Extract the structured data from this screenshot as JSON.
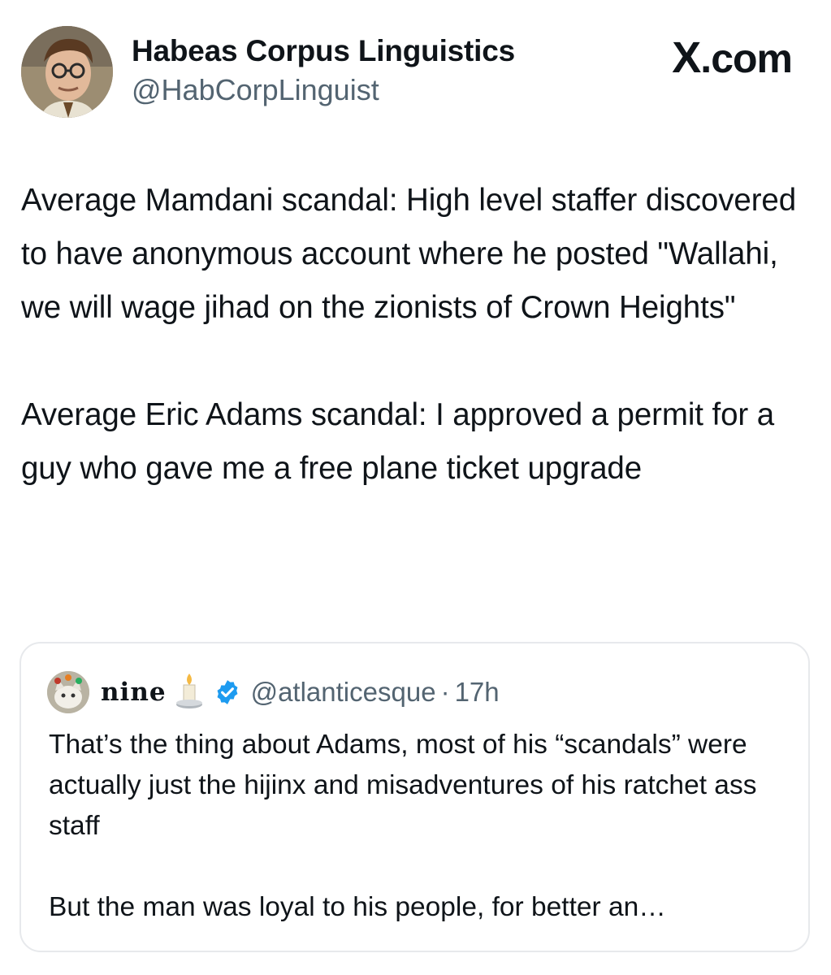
{
  "post": {
    "author_name": "Habeas Corpus Linguistics",
    "author_handle": "@HabCorpLinguist",
    "brand_x": "X",
    "brand_suffix": ".com",
    "paragraphs": [
      "Average Mamdani scandal: High level staffer discovered to have anonymous account where he posted \"Wallahi, we will wage jihad on the zionists of Crown Heights\"",
      "Average Eric Adams scandal: I approved a permit for a guy who gave me a free plane ticket upgrade"
    ]
  },
  "quoted": {
    "author_name": "nine",
    "author_emoji_icon": "candle-icon",
    "verified_icon": "verified-badge-icon",
    "author_handle": "@atlanticesque",
    "separator": "·",
    "time": "17h",
    "paragraphs": [
      "That’s the thing about Adams, most of his “scandals” were actually just the hijinx and misadventures of his ratchet ass staff",
      "But the man was loyal to his people, for better an…"
    ]
  },
  "colors": {
    "text": "#0f1419",
    "secondary": "#536471",
    "verified": "#1d9bf0",
    "border": "#e7e9ec"
  }
}
